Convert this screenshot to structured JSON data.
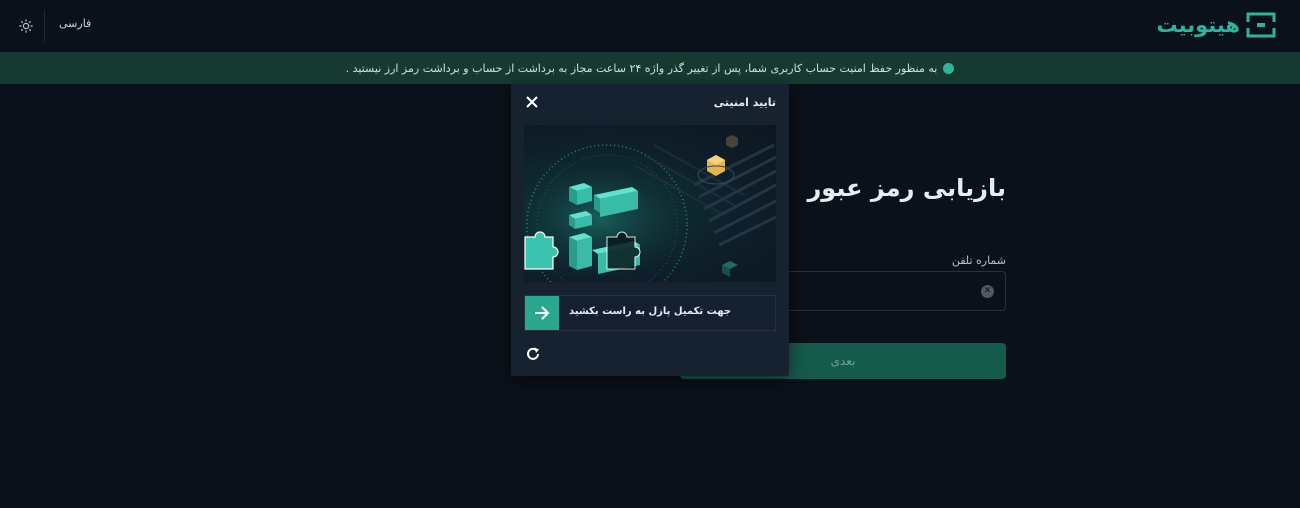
{
  "header": {
    "language_label": "فارسی",
    "theme_icon": "sun-icon",
    "logo_text": "هیتوبیت"
  },
  "banner": {
    "text": "به منظور حفظ امنیت حساب کاربری شما، پس از تغییر گذر واژه ۲۴ ساعت مجاز به برداشت از حساب و برداشت رمز ارز نیستید ."
  },
  "form": {
    "title": "بازیابی رمز عبور",
    "phone_label": "شماره تلفن",
    "phone_value": "",
    "next_label": "بعدی"
  },
  "captcha": {
    "title": "تایید امنیتی",
    "slider_text": "جهت تکمیل پازل به راست بکشید",
    "close_icon": "close-icon",
    "refresh_icon": "refresh-icon",
    "handle_icon": "arrow-right-icon"
  },
  "colors": {
    "background": "#0b111a",
    "accent": "#2aa88f",
    "banner": "#163a32",
    "modal": "#172230"
  }
}
